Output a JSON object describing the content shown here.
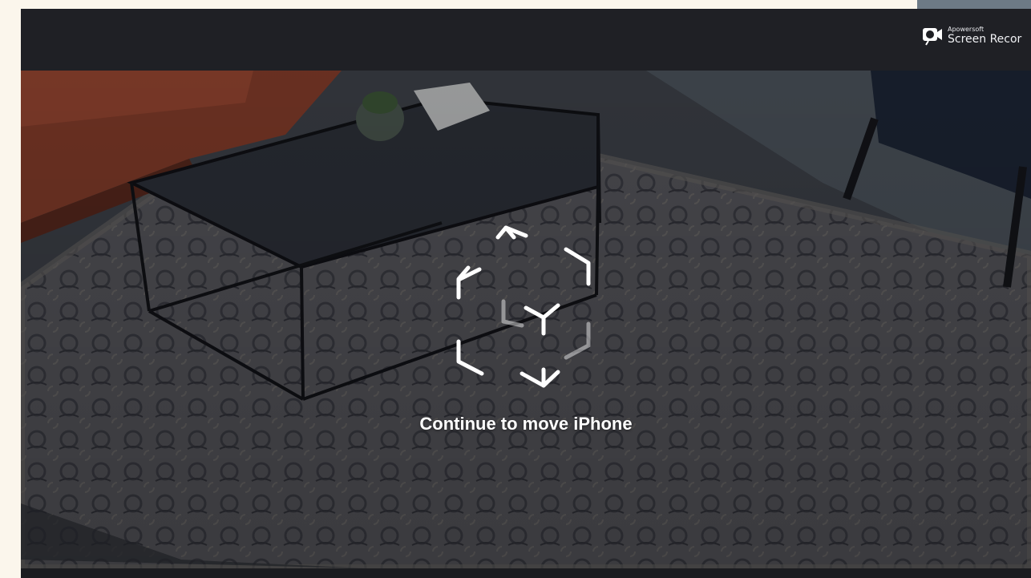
{
  "watermark": {
    "brand": "Apowersoft",
    "product": "Screen Recor",
    "icon": "camera-icon"
  },
  "overlay": {
    "icon": "ar-cube-move-icon",
    "instruction": "Continue to move iPhone"
  },
  "colors": {
    "page_background": "#fbf6ec",
    "top_bar": "#1f2025",
    "overlay_text": "#ffffff",
    "sofa": "#8a3f2c",
    "chair": "#1e2738"
  }
}
